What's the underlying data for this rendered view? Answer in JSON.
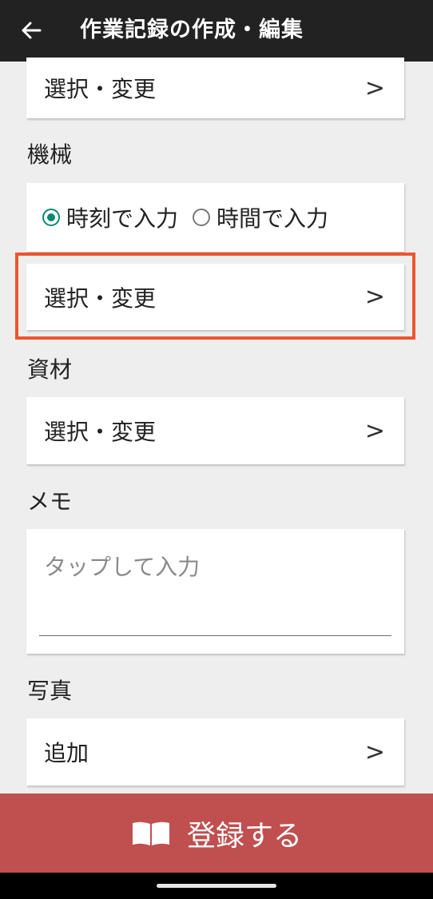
{
  "appbar": {
    "title": "作業記録の作成・編集"
  },
  "top_select": {
    "label": "選択・変更",
    "chevron": ">"
  },
  "machine": {
    "label": "機械",
    "radio_options": [
      {
        "label": "時刻で入力",
        "selected": true
      },
      {
        "label": "時間で入力",
        "selected": false
      }
    ],
    "select_label": "選択・変更",
    "chevron": ">"
  },
  "materials": {
    "label": "資材",
    "select_label": "選択・変更",
    "chevron": ">"
  },
  "memo": {
    "label": "メモ",
    "placeholder": "タップして入力"
  },
  "photo": {
    "label": "写真",
    "add_label": "追加",
    "chevron": ">"
  },
  "register_button": {
    "label": "登録する",
    "icon": "book-icon"
  },
  "colors": {
    "appbar": "#222222",
    "accent_radio": "#0a8a70",
    "register": "#c05050",
    "highlight": "#ee5530"
  }
}
